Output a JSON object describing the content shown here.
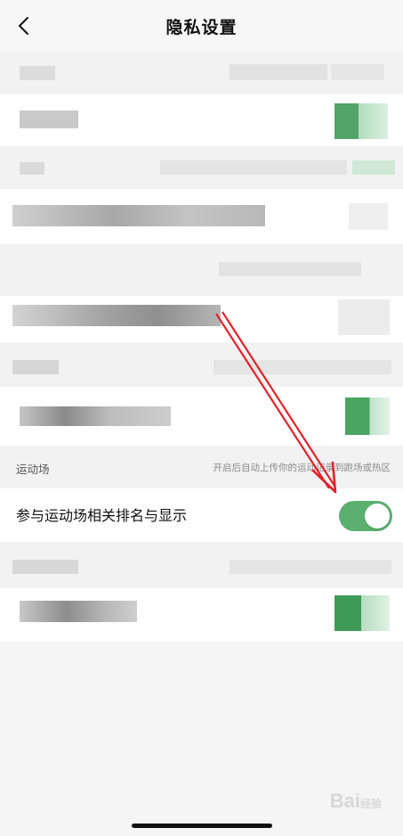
{
  "nav": {
    "title": "隐私设置",
    "back_icon": "chevron-left-icon"
  },
  "sections": {
    "sports_ground": {
      "header_label": "运动场",
      "header_hint": "开启后自动上传你的运动记录到跑场或热区",
      "row_label": "参与运动场相关排名与显示",
      "toggle_on": true
    }
  },
  "watermark": {
    "text": "Bai",
    "suffix": "经验"
  },
  "colors": {
    "toggle_on": "#5bb070",
    "annotation_arrow": "#e0232a",
    "page_bg": "#f5f5f5"
  }
}
